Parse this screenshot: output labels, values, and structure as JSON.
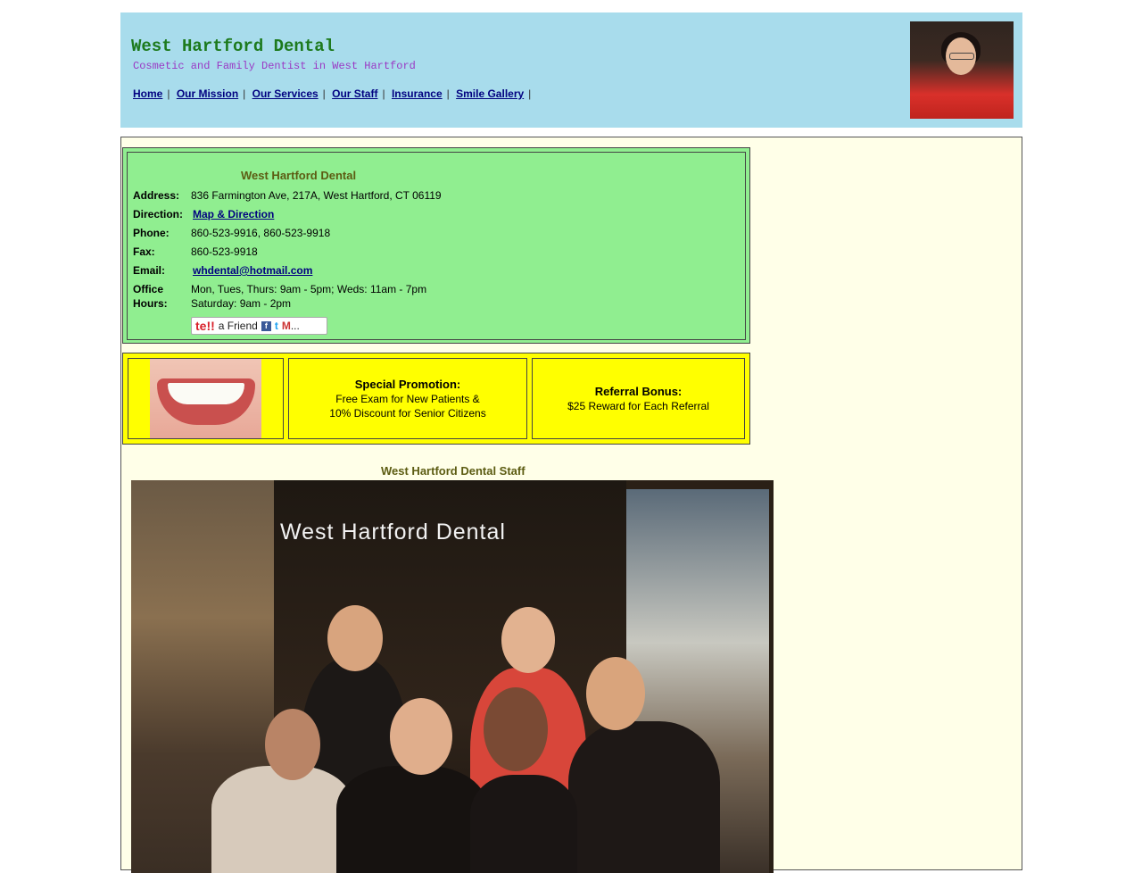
{
  "header": {
    "title": "West Hartford Dental",
    "tagline": "Cosmetic and Family Dentist in West Hartford",
    "nav": [
      "Home",
      "Our Mission",
      "Our Services",
      "Our Staff",
      "Insurance",
      "Smile Gallery"
    ],
    "nav_trailing_separator": "|"
  },
  "contact": {
    "title": "West Hartford Dental",
    "address_label": "Address:",
    "address": "836 Farmington Ave, 217A, West Hartford, CT 06119",
    "direction_label": "Direction:",
    "direction_link": "Map & Direction",
    "phone_label": "Phone:",
    "phone": "860-523-9916, 860-523-9918",
    "fax_label": "Fax:",
    "fax": "860-523-9918",
    "email_label": "Email:",
    "email": "whdental@hotmail.com",
    "hours_label_1": "Office",
    "hours_label_2": "Hours:",
    "hours_line_1": "Mon, Tues, Thurs: 9am - 5pm; Weds: 11am - 7pm",
    "hours_line_2": "Saturday: 9am - 2pm",
    "tell_friend": {
      "brand": "te!!",
      "text": "a Friend",
      "facebook": "f",
      "twitter": "t",
      "gmail": "M",
      "more": "..."
    }
  },
  "promo": {
    "special_title": "Special Promotion:",
    "special_line_1": "Free Exam for New Patients &",
    "special_line_2": "10% Discount for Senior Citizens",
    "referral_title": "Referral Bonus:",
    "referral_line": "$25 Reward for Each Referral"
  },
  "staff": {
    "caption": "West Hartford Dental Staff",
    "photo_sign": "West  Hartford  Dental"
  },
  "colors": {
    "header_bg": "#a8dcec",
    "title": "#1d7a1d",
    "tagline": "#9a38c4",
    "contact_bg": "#90ee90",
    "promo_bg": "#ffff00",
    "main_bg": "#ffffe8"
  }
}
